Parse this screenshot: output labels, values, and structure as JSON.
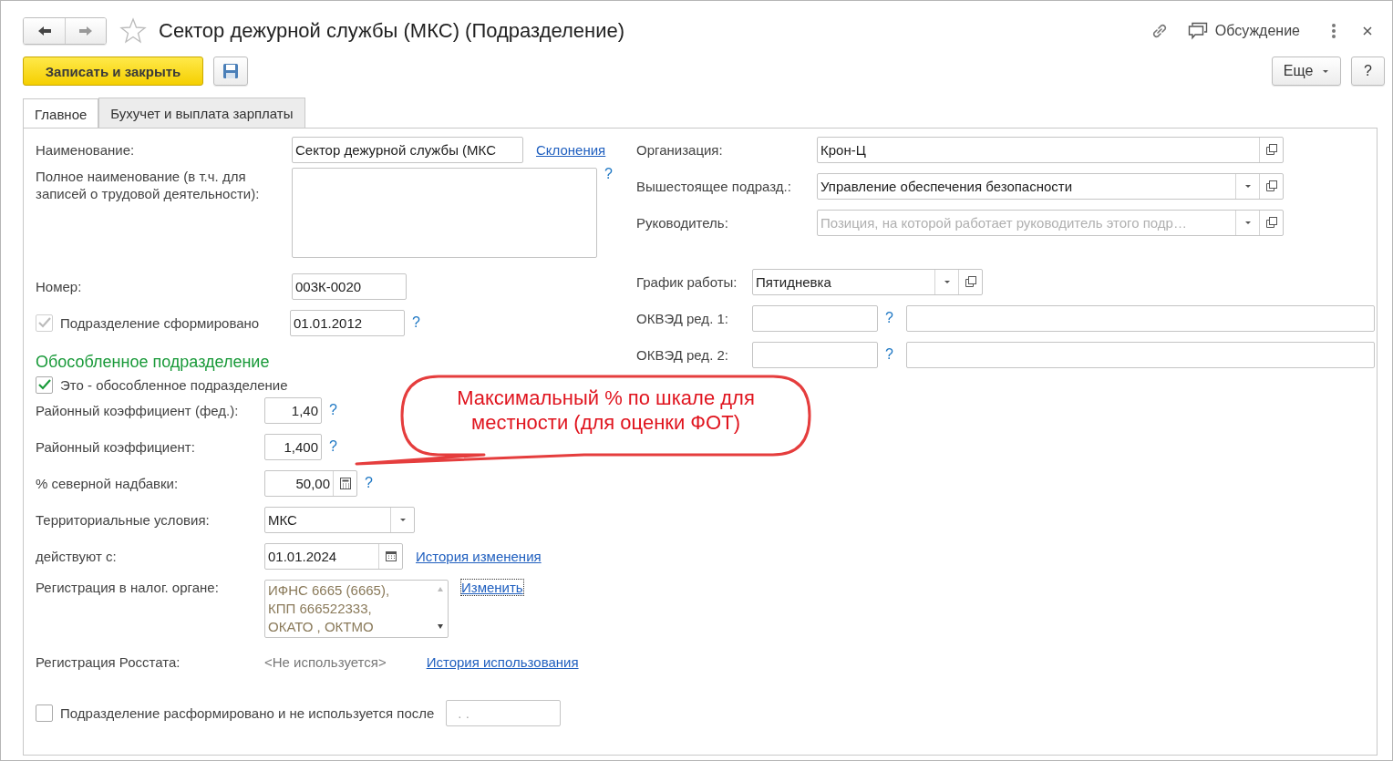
{
  "window": {
    "title": "Сектор дежурной службы (МКС) (Подразделение)",
    "favorite": false,
    "discussion": "Обсуждение"
  },
  "toolbar": {
    "save_close": "Записать и закрыть",
    "more": "Еще",
    "help": "?"
  },
  "tabs": [
    {
      "label": "Главное",
      "selected": true
    },
    {
      "label": "Бухучет и выплата зарплаты",
      "selected": false
    }
  ],
  "left": {
    "name": {
      "label": "Наименование:",
      "value": "Сектор дежурной службы (МКС",
      "link": "Склонения"
    },
    "full_name": {
      "label": "Полное наименование (в т.ч. для записей о трудовой деятельности):",
      "help": "?"
    },
    "number": {
      "label": "Номер:",
      "value": "003К-0020"
    },
    "formed": {
      "label": "Подразделение сформировано",
      "checked": true,
      "disabled": true,
      "date": "01.01.2012",
      "help": "?"
    },
    "section_title": "Обособленное подразделение",
    "separate": {
      "label": "Это - обособленное подразделение",
      "checked": true,
      "disabled": false
    },
    "coeff_fed": {
      "label": "Районный коэффициент (фед.):",
      "value": "1,40",
      "help": "?"
    },
    "coeff": {
      "label": "Районный коэффициент:",
      "value": "1,400",
      "help": "?"
    },
    "north": {
      "label": "% северной надбавки:",
      "value": "50,00",
      "help": "?"
    },
    "territory": {
      "label": "Территориальные условия:",
      "value": "МКС"
    },
    "since": {
      "label": "действуют с:",
      "value": "01.01.2024",
      "link": "История изменения"
    },
    "tax": {
      "label": "Регистрация в налог. органе:",
      "lines": [
        "ИФНС 6665 (6665),",
        "КПП 666522333,",
        "ОКАТО , ОКТМО"
      ],
      "link": "Изменить"
    },
    "rosstat": {
      "label": "Регистрация Росстата:",
      "value": "<Не используется>",
      "link": "История использования"
    },
    "disbanded": {
      "label": "Подразделение расформировано и не используется после",
      "checked": false,
      "disabled": false,
      "date": ". ."
    }
  },
  "right": {
    "organization": {
      "label": "Организация:",
      "value": "Крон-Ц"
    },
    "parent": {
      "label": "Вышестоящее подразд.:",
      "value": "Управление обеспечения безопасности"
    },
    "head": {
      "label": "Руководитель:",
      "placeholder": "Позиция, на которой работает руководитель этого подр…"
    },
    "schedule": {
      "label": "График работы:",
      "value": "Пятидневка"
    },
    "okved": [
      {
        "label": "ОКВЭД ред. 1:",
        "help": "?"
      },
      {
        "label": "ОКВЭД ред. 2:",
        "help": "?"
      }
    ]
  },
  "callout": {
    "lines": [
      "Максимальный % по шкале для",
      "местности (для оценки ФОТ)"
    ]
  }
}
